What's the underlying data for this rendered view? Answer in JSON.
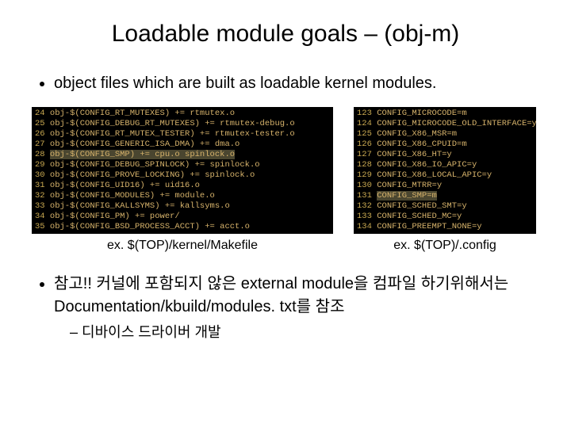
{
  "title": "Loadable module goals – (obj-m)",
  "bullet1": "object files which are built as loadable kernel modules.",
  "left_caption": "ex. $(TOP)/kernel/Makefile",
  "right_caption": "ex. $(TOP)/.config",
  "bullet2_line1": "참고!! 커널에 포함되지 않은 external module을 컴파일 하기위해서는",
  "bullet2_line2": "Documentation/kbuild/modules. txt를 참조",
  "sub1": "디바이스 드라이버 개발",
  "makefile": [
    {
      "n": "24",
      "t": "obj-$(CONFIG_RT_MUTEXES) += rtmutex.o",
      "hl": false
    },
    {
      "n": "25",
      "t": "obj-$(CONFIG_DEBUG_RT_MUTEXES) += rtmutex-debug.o",
      "hl": false
    },
    {
      "n": "26",
      "t": "obj-$(CONFIG_RT_MUTEX_TESTER) += rtmutex-tester.o",
      "hl": false
    },
    {
      "n": "27",
      "t": "obj-$(CONFIG_GENERIC_ISA_DMA) += dma.o",
      "hl": false
    },
    {
      "n": "28",
      "t": "obj-$(CONFIG_SMP) += cpu.o spinlock.o",
      "hl": true
    },
    {
      "n": "29",
      "t": "obj-$(CONFIG_DEBUG_SPINLOCK) += spinlock.o",
      "hl": false
    },
    {
      "n": "30",
      "t": "obj-$(CONFIG_PROVE_LOCKING) += spinlock.o",
      "hl": false
    },
    {
      "n": "31",
      "t": "obj-$(CONFIG_UID16) += uid16.o",
      "hl": false
    },
    {
      "n": "32",
      "t": "obj-$(CONFIG_MODULES) += module.o",
      "hl": false
    },
    {
      "n": "33",
      "t": "obj-$(CONFIG_KALLSYMS) += kallsyms.o",
      "hl": false
    },
    {
      "n": "34",
      "t": "obj-$(CONFIG_PM) += power/",
      "hl": false
    },
    {
      "n": "35",
      "t": "obj-$(CONFIG_BSD_PROCESS_ACCT) += acct.o",
      "hl": false
    }
  ],
  "config": [
    {
      "n": "123",
      "t": "CONFIG_MICROCODE=m",
      "hl": false
    },
    {
      "n": "124",
      "t": "CONFIG_MICROCODE_OLD_INTERFACE=y",
      "hl": false
    },
    {
      "n": "125",
      "t": "CONFIG_X86_MSR=m",
      "hl": false
    },
    {
      "n": "126",
      "t": "CONFIG_X86_CPUID=m",
      "hl": false
    },
    {
      "n": "127",
      "t": "CONFIG_X86_HT=y",
      "hl": false
    },
    {
      "n": "128",
      "t": "CONFIG_X86_IO_APIC=y",
      "hl": false
    },
    {
      "n": "129",
      "t": "CONFIG_X86_LOCAL_APIC=y",
      "hl": false
    },
    {
      "n": "130",
      "t": "CONFIG_MTRR=y",
      "hl": false
    },
    {
      "n": "131",
      "t": "CONFIG_SMP=m",
      "hl": true
    },
    {
      "n": "132",
      "t": "CONFIG_SCHED_SMT=y",
      "hl": false
    },
    {
      "n": "133",
      "t": "CONFIG_SCHED_MC=y",
      "hl": false
    },
    {
      "n": "134",
      "t": "CONFIG_PREEMPT_NONE=y",
      "hl": false
    }
  ]
}
